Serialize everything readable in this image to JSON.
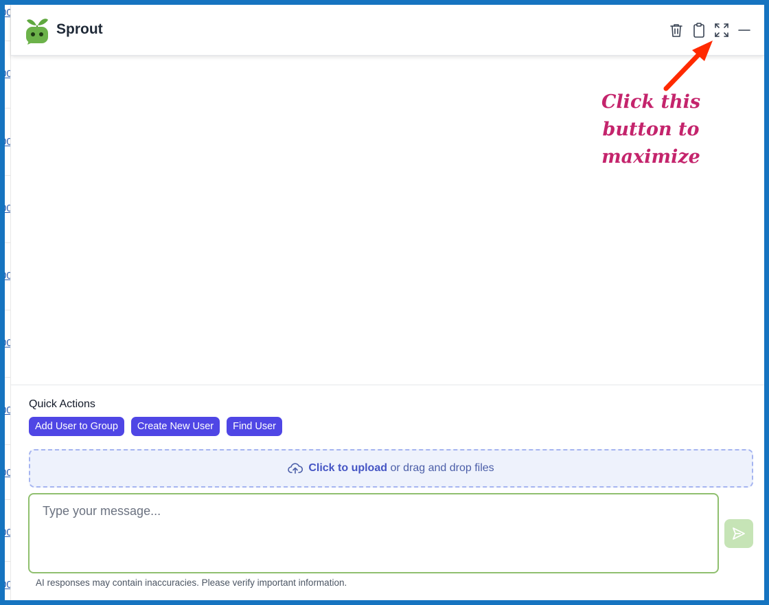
{
  "app": {
    "title": "Sprout"
  },
  "header": {
    "icons": [
      "trash-icon",
      "clipboard-icon",
      "maximize-icon",
      "minimize-icon"
    ]
  },
  "annotation": {
    "lines": [
      "Click this",
      "button to",
      "maximize"
    ],
    "color": "#c4246c",
    "arrow_color": "#ff2a00"
  },
  "background_page": {
    "link_fragment": "00"
  },
  "quick_actions": {
    "title": "Quick Actions",
    "buttons": [
      "Add User to Group",
      "Create New User",
      "Find User"
    ]
  },
  "upload": {
    "action": "Click to upload",
    "rest": "or drag and drop files"
  },
  "message": {
    "placeholder": "Type your message...",
    "value": ""
  },
  "disclaimer": "AI responses may contain inaccuracies. Please verify important information.",
  "colors": {
    "frame": "#1674c0",
    "accent": "#4f46e5",
    "input_border": "#8fbf6e",
    "send_bg": "#c6e4b6"
  }
}
